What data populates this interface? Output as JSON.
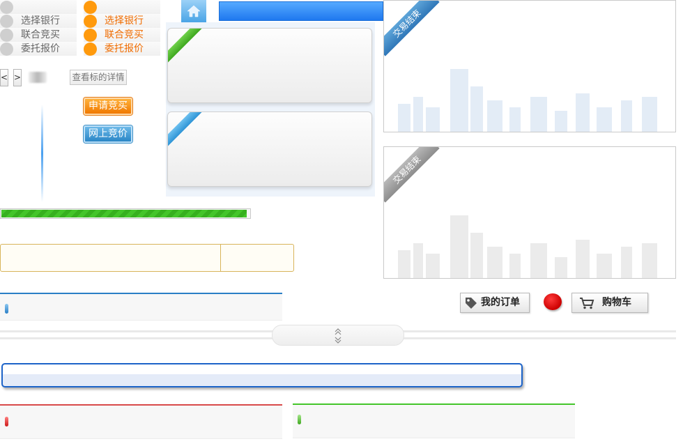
{
  "steps": {
    "grey": [
      "选择银行",
      "联合竞买",
      "委托报价"
    ],
    "orange": [
      "选择银行",
      "联合竞买",
      "委托报价"
    ]
  },
  "pager": {
    "prev": "<",
    "next": ">"
  },
  "detail_button": "查看标的详情",
  "apply_button": "申请竞买",
  "online_bid_button": "网上竞价",
  "trade_panels": [
    {
      "ribbon": "交易结束",
      "theme": "blue"
    },
    {
      "ribbon": "交易结束",
      "theme": "grey"
    }
  ],
  "progress": {
    "value": 0.99,
    "color": "#37b01f"
  },
  "orders_button": "我的订单",
  "cart_button": "购物车",
  "colors": {
    "blue_accent": "#1f78ef",
    "orange_accent": "#f07800",
    "green_accent": "#44c52a",
    "red_accent": "#cc0000",
    "tab_blue": "#2a7fc6",
    "tab_red": "#d84a4a",
    "tab_green": "#44c52a"
  },
  "icons": [
    "home-icon",
    "tag-icon",
    "cart-icon",
    "chevron-up-double-icon",
    "chevron-down-double-icon"
  ]
}
